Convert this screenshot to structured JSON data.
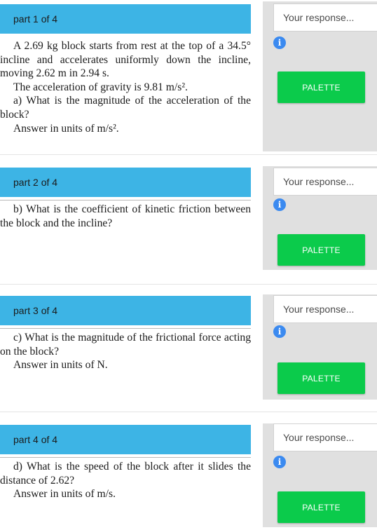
{
  "parts": [
    {
      "header": "part 1 of 4",
      "lines": [
        "A 2.69 kg block starts from rest at the top of a 34.5° incline and accelerates uniformly down the incline, moving 2.62 m in 2.94 s.",
        "The acceleration of gravity is 9.81 m/s².",
        "a) What is the magnitude of the acceleration of the block?",
        "Answer in units of m/s²."
      ],
      "response_placeholder": "Your response...",
      "info_glyph": "i",
      "palette_label": "PALETTE"
    },
    {
      "header": "part 2 of 4",
      "lines": [
        "b) What is the coefficient of kinetic friction between the block and the incline?"
      ],
      "response_placeholder": "Your response...",
      "info_glyph": "i",
      "palette_label": "PALETTE"
    },
    {
      "header": "part 3 of 4",
      "lines": [
        "c) What is the magnitude of the frictional force acting on the block?",
        "Answer in units of N."
      ],
      "response_placeholder": "Your response...",
      "info_glyph": "i",
      "palette_label": "PALETTE"
    },
    {
      "header": "part 4 of 4",
      "lines": [
        "d) What is the speed of the block after it slides the distance of 2.62?",
        "Answer in units of m/s."
      ],
      "response_placeholder": "Your response...",
      "info_glyph": "i",
      "palette_label": "PALETTE"
    }
  ],
  "colors": {
    "header_bg": "#3db4e5",
    "palette_bg": "#0bcb4b",
    "info_bg": "#3b8af0",
    "panel_bg": "#e0e0e0"
  }
}
